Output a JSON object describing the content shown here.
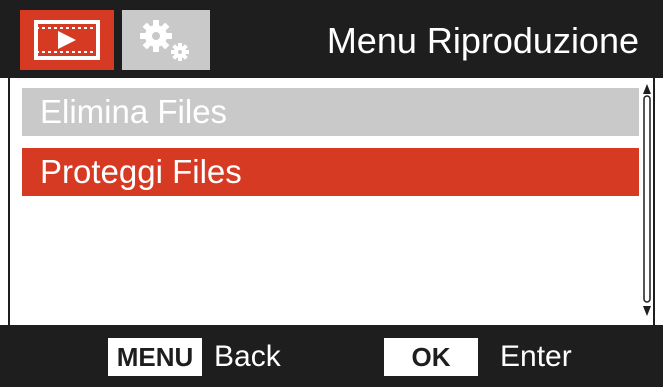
{
  "header": {
    "title": "Menu Riproduzione",
    "tabs": [
      {
        "icon": "playback-icon",
        "active": true
      },
      {
        "icon": "settings-gears-icon",
        "active": false
      }
    ]
  },
  "menu": {
    "items": [
      {
        "label": "Elimina Files",
        "state": "normal"
      },
      {
        "label": "Proteggi Files",
        "state": "selected"
      }
    ]
  },
  "footer": {
    "menu_key": "MENU",
    "menu_action": "Back",
    "ok_key": "OK",
    "ok_action": "Enter"
  },
  "colors": {
    "accent": "#d63a22",
    "dark": "#1e1e1e",
    "item_gray": "#c9c9c9",
    "text_light": "#ffffff"
  }
}
